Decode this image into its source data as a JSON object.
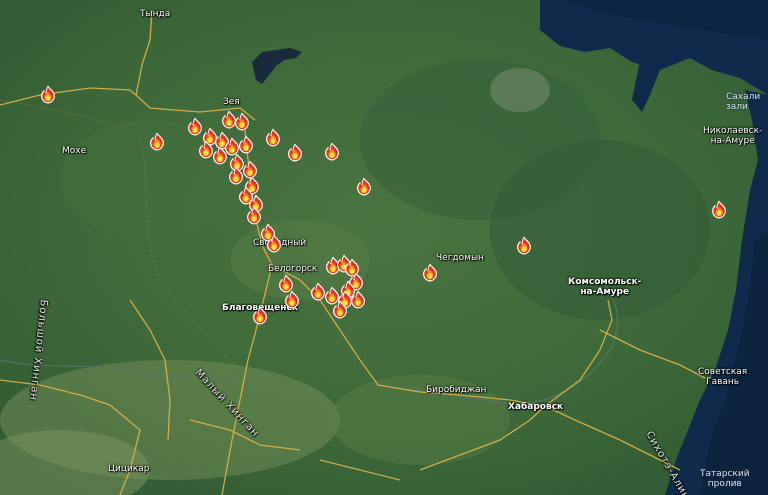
{
  "colors": {
    "forest": "#3c6a3a",
    "sea": "#0f2a4a",
    "road": "#e0b44a",
    "fire_outer": "#e8321e",
    "fire_mid": "#f58a1f",
    "fire_inner": "#ffe23a"
  },
  "icon": "fire-icon",
  "labels": {
    "tynda": "Тында",
    "zeya": "Зея",
    "mokhe": "Мохе",
    "svobodny": "Свободный",
    "belogorsk": "Белогорск",
    "blagoveshchensk": "Благовещенск",
    "chegdomyn": "Чегдомын",
    "komsomolsk": "Комсомольск-\nна-Амуре",
    "nikolaevsk": "Николаевск-\nна-Амуре",
    "sakhalin_gulf": "Сахали\nзали",
    "sovetskaya": "Советская\nГавань",
    "birobidzhan": "Биробиджан",
    "khabarovsk": "Хабаровск",
    "tsitsikar": "Цицикар",
    "tatar_strait": "Татарский\nпролив",
    "maly_khingan": "Малый Хинган",
    "bolshoy_khingan": "Большой Хинган",
    "sikhote_alin": "Сихотэ-Алинь"
  }
}
